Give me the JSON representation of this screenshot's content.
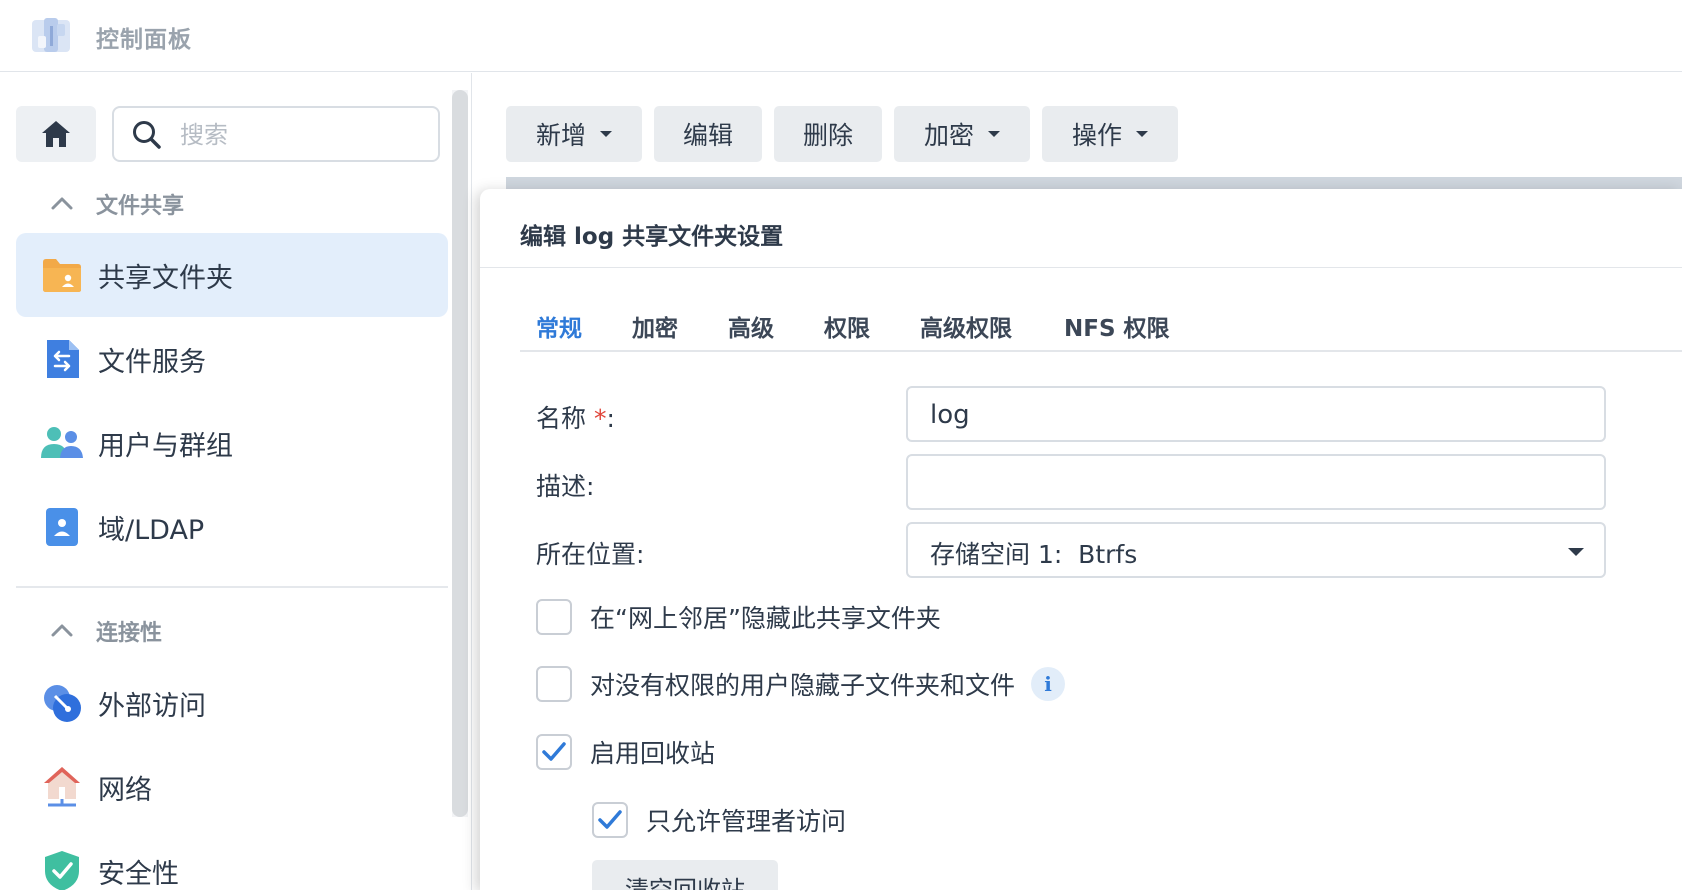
{
  "app": {
    "title": "控制面板",
    "icon": "control-panel-icon"
  },
  "sidebar": {
    "home_icon": "home-icon",
    "search": {
      "placeholder": "搜索",
      "value": ""
    },
    "sections": [
      {
        "title": "文件共享",
        "items": [
          {
            "label": "共享文件夹",
            "icon": "shared-folder-icon",
            "active": true
          },
          {
            "label": "文件服务",
            "icon": "file-services-icon"
          },
          {
            "label": "用户与群组",
            "icon": "users-groups-icon"
          },
          {
            "label": "域/LDAP",
            "icon": "domain-ldap-icon"
          }
        ]
      },
      {
        "title": "连接性",
        "items": [
          {
            "label": "外部访问",
            "icon": "external-access-icon"
          },
          {
            "label": "网络",
            "icon": "network-icon"
          },
          {
            "label": "安全性",
            "icon": "security-shield-icon"
          }
        ]
      }
    ]
  },
  "toolbar": {
    "create": "新增",
    "edit": "编辑",
    "delete": "删除",
    "encrypt": "加密",
    "action": "操作"
  },
  "dialog": {
    "title": "编辑 log 共享文件夹设置",
    "tabs": [
      "常规",
      "加密",
      "高级",
      "权限",
      "高级权限",
      "NFS 权限"
    ],
    "active_tab": "常规",
    "fields": {
      "name_label": "名称",
      "name_required": "*",
      "name_colon": ":",
      "name_value": "log",
      "desc_label": "描述:",
      "desc_value": "",
      "location_label": "所在位置:",
      "location_value": "存储空间 1:  Btrfs"
    },
    "checkboxes": [
      {
        "label": "在“网上邻居”隐藏此共享文件夹",
        "checked": false
      },
      {
        "label": "对没有权限的用户隐藏子文件夹和文件",
        "checked": false,
        "info": "i"
      },
      {
        "label": "启用回收站",
        "checked": true
      },
      {
        "label": "只允许管理者访问",
        "checked": true
      }
    ],
    "empty_recycle_label": "清空回收站"
  },
  "colors": {
    "accent": "#2f7ad8",
    "active_bg": "#e3eefb",
    "required": "#e0453a"
  }
}
